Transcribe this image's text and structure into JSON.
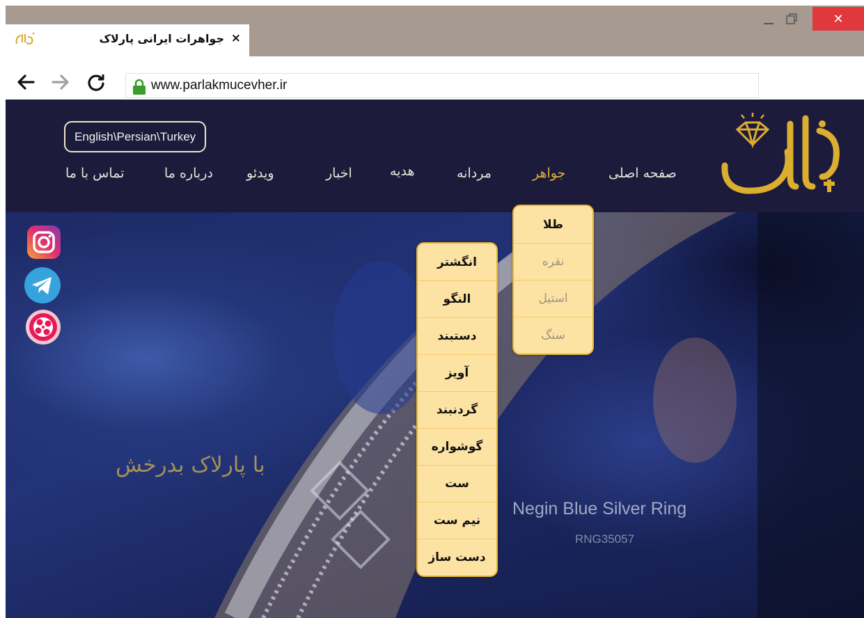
{
  "browser": {
    "tab_title": "جواهرات ایرانی پارلاک",
    "tab_close": "×",
    "close_glyph": "✕",
    "url": "www.parlakmucevher.ir"
  },
  "site": {
    "language_switch": "English\\Persian\\Turkey",
    "nav": {
      "home": "صفحه اصلی",
      "jewelry": "جواهر",
      "men": "مردانه",
      "gift": "هدیه",
      "news": "اخبار",
      "video": "ویدئو",
      "about": "درباره ما",
      "contact": "تماس با ما"
    },
    "active_nav": "jewelry",
    "social": [
      "instagram-icon",
      "telegram-icon",
      "aparat-icon"
    ],
    "hero_caption": "با پارلاک بدرخش",
    "product_name": "Negin Blue Silver Ring",
    "product_code": "RNG35057"
  },
  "menus": {
    "material": [
      "طلا",
      "نقره",
      "استیل",
      "سنگ"
    ],
    "material_highlighted": "طلا",
    "category": [
      "انگشتر",
      "النگو",
      "دستبند",
      "آویز",
      "گردنبند",
      "گوشواره",
      "ست",
      "نیم ست",
      "دست ساز"
    ]
  },
  "colors": {
    "header_bg": "#1c1b3b",
    "accent_gold": "#e0b233",
    "menu_bg": "#fde3a3",
    "menu_border": "#e6b530",
    "close_red": "#e0383c"
  }
}
